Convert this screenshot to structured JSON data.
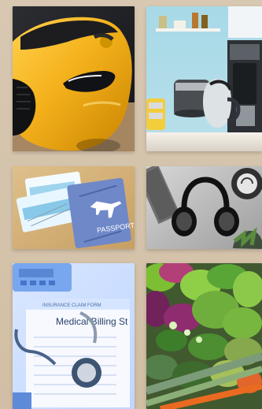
{
  "gallery": {
    "tiles": [
      {
        "icon": "car-image"
      },
      {
        "icon": "kitchen-appliances-image"
      },
      {
        "icon": "travel-passport-image",
        "passport_label": "PASSPORT"
      },
      {
        "icon": "headphones-image"
      },
      {
        "icon": "medical-billing-image",
        "doc_header": "INSURANCE CLAIM FORM",
        "doc_title": "Medical Billing St"
      },
      {
        "icon": "vegetables-image"
      }
    ]
  },
  "colors": {
    "background": "#d4c3ab",
    "car": "#f3b11a",
    "passport": "#6f88c8",
    "document": "#f7f9ff"
  }
}
